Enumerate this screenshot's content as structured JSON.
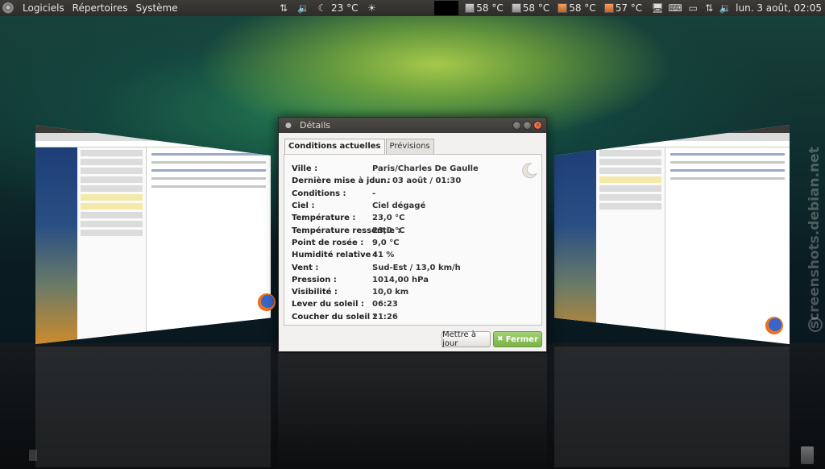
{
  "top_panel": {
    "menus": [
      "Logiciels",
      "Répertoires",
      "Système"
    ],
    "weather_temp": "23 °C",
    "sensors": [
      "58 °C",
      "58 °C",
      "58 °C",
      "57 °C"
    ],
    "datetime": "lun.  3 août, 02:05"
  },
  "dialog": {
    "title": "Détails",
    "tabs": [
      "Conditions actuelles",
      "Prévisions"
    ],
    "rows": [
      {
        "label": "Ville :",
        "value": "Paris/Charles De Gaulle"
      },
      {
        "label": "Dernière mise à jour :",
        "value": "lun. 03 août / 01:30"
      },
      {
        "label": "Conditions :",
        "value": "-"
      },
      {
        "label": "Ciel :",
        "value": "Ciel dégagé"
      },
      {
        "label": "Température :",
        "value": "23,0 °C"
      },
      {
        "label": "Température ressentie :",
        "value": "23,0 °C"
      },
      {
        "label": "Point de rosée :",
        "value": "9,0 °C"
      },
      {
        "label": "Humidité relative :",
        "value": "41 %"
      },
      {
        "label": "Vent :",
        "value": "Sud-Est / 13,0 km/h"
      },
      {
        "label": "Pression :",
        "value": "1014,00 hPa"
      },
      {
        "label": "Visibilité :",
        "value": "10,0 km"
      },
      {
        "label": "Lever du soleil :",
        "value": "06:23"
      },
      {
        "label": "Coucher du soleil :",
        "value": "21:26"
      }
    ],
    "buttons": {
      "update": "Mettre à jour",
      "close": "Fermer"
    }
  },
  "watermark": "screenshots.debian.net",
  "icons": {
    "weather": "moon-icon",
    "sun": "sun-icon",
    "network": "network-arrows-icon",
    "volume": "volume-icon"
  }
}
